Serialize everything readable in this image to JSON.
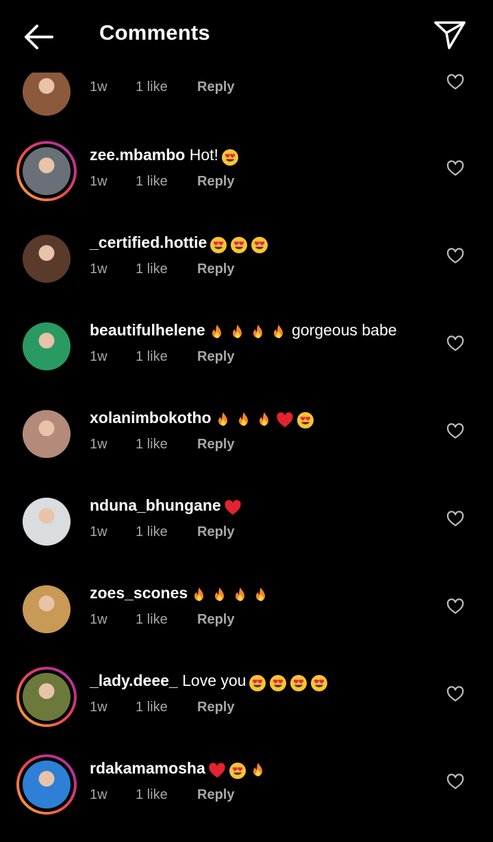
{
  "header": {
    "title": "Comments"
  },
  "comments": [
    {
      "user": "",
      "text": "",
      "time": "1w",
      "likes": "1 like",
      "reply": "Reply",
      "emojis": [],
      "story": false,
      "avatar": "#8b5a3c"
    },
    {
      "user": "zee.mbambo",
      "text": " Hot!",
      "time": "1w",
      "likes": "1 like",
      "reply": "Reply",
      "emojis": [
        "heart-eyes-emoji"
      ],
      "story": true,
      "avatar": "#6a7077"
    },
    {
      "user": "_certified.hottie",
      "text": "",
      "time": "1w",
      "likes": "1 like",
      "reply": "Reply",
      "emojis": [
        "heart-eyes-emoji",
        "heart-eyes-emoji",
        "heart-eyes-emoji"
      ],
      "story": false,
      "avatar": "#5a3a2b"
    },
    {
      "user": "beautifulhelene",
      "text": " gorgeous babe",
      "time": "1w",
      "likes": "1 like",
      "reply": "Reply",
      "emojis": [
        "fire-emoji",
        "fire-emoji",
        "fire-emoji",
        "fire-emoji"
      ],
      "story": false,
      "avatar": "#2a9a63",
      "emojiBeforeText": true
    },
    {
      "user": "xolanimbokotho",
      "text": "",
      "time": "1w",
      "likes": "1 like",
      "reply": "Reply",
      "emojis": [
        "fire-emoji",
        "fire-emoji",
        "fire-emoji",
        "red-heart-emoji",
        "heart-eyes-emoji"
      ],
      "story": false,
      "avatar": "#b48a7a"
    },
    {
      "user": "nduna_bhungane",
      "text": "",
      "time": "1w",
      "likes": "1 like",
      "reply": "Reply",
      "emojis": [
        "red-heart-emoji"
      ],
      "story": false,
      "avatar": "#d9dde0"
    },
    {
      "user": "zoes_scones",
      "text": "",
      "time": "1w",
      "likes": "1 like",
      "reply": "Reply",
      "emojis": [
        "fire-emoji",
        "fire-emoji",
        "fire-emoji",
        "fire-emoji"
      ],
      "story": false,
      "avatar": "#c99a55"
    },
    {
      "user": "_lady.deee_",
      "text": " Love you",
      "time": "1w",
      "likes": "1 like",
      "reply": "Reply",
      "emojis": [
        "heart-eyes-emoji",
        "heart-eyes-emoji",
        "heart-eyes-emoji",
        "heart-eyes-emoji"
      ],
      "story": true,
      "avatar": "#6b7a3a"
    },
    {
      "user": "rdakamamosha",
      "text": "",
      "time": "1w",
      "likes": "1 like",
      "reply": "Reply",
      "emojis": [
        "red-heart-emoji",
        "heart-eyes-emoji",
        "fire-emoji"
      ],
      "story": true,
      "avatar": "#2e7fd6"
    }
  ]
}
